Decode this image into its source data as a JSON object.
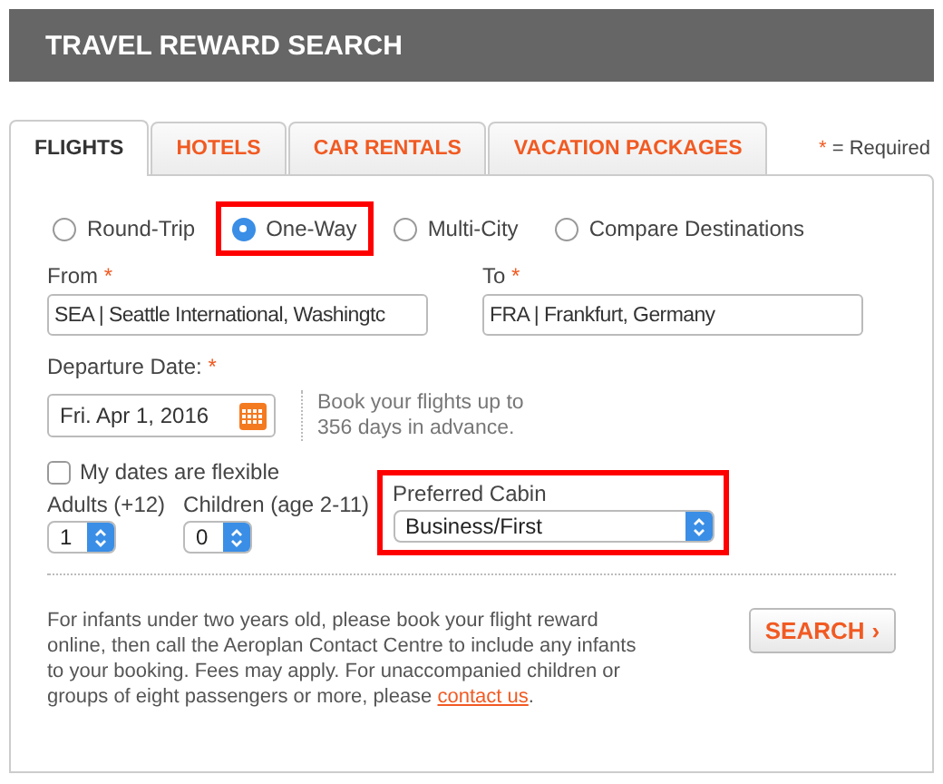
{
  "header": {
    "title": "TRAVEL REWARD SEARCH"
  },
  "tabs": [
    {
      "label": "FLIGHTS",
      "selected": true
    },
    {
      "label": "HOTELS",
      "selected": false
    },
    {
      "label": "CAR RENTALS",
      "selected": false
    },
    {
      "label": "VACATION PACKAGES",
      "selected": false
    }
  ],
  "required_note": {
    "mark": "*",
    "text": "= Required"
  },
  "trip_types": [
    {
      "label": "Round-Trip",
      "selected": false,
      "highlighted": false
    },
    {
      "label": "One-Way",
      "selected": true,
      "highlighted": true
    },
    {
      "label": "Multi-City",
      "selected": false,
      "highlighted": false
    },
    {
      "label": "Compare Destinations",
      "selected": false,
      "highlighted": false
    }
  ],
  "from": {
    "label": "From",
    "required_mark": "*",
    "value": "SEA | Seattle International, Washingtc"
  },
  "to": {
    "label": "To",
    "required_mark": "*",
    "value": "FRA | Frankfurt, Germany"
  },
  "departure": {
    "label": "Departure Date:",
    "required_mark": "*",
    "value": "Fri. Apr 1, 2016",
    "hint": "Book your flights up to 356 days in advance."
  },
  "flexible": {
    "label": "My dates are flexible",
    "checked": false
  },
  "adults": {
    "label": "Adults (+12)",
    "value": "1"
  },
  "children": {
    "label": "Children (age 2-11)",
    "value": "0"
  },
  "cabin": {
    "label": "Preferred Cabin",
    "value": "Business/First",
    "highlighted": true
  },
  "infant_note": {
    "text": "For infants under two years old, please book your flight reward online, then call the Aeroplan Contact Centre to include any infants to your booking. Fees may apply. For unaccompanied children or groups of eight passengers or more, please ",
    "link": "contact us",
    "after": "."
  },
  "search_button": {
    "label": "SEARCH",
    "arrow": "›"
  }
}
